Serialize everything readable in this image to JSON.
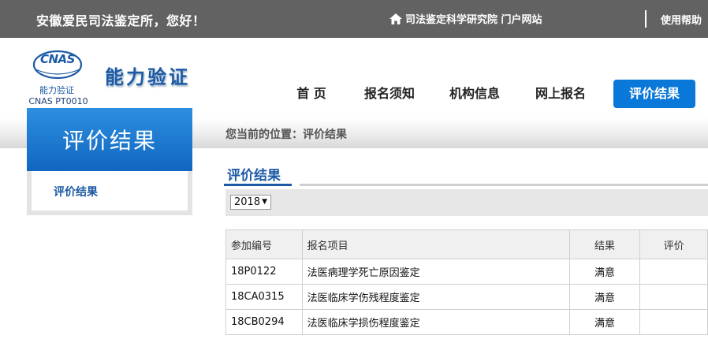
{
  "topbar": {
    "greeting": "安徽爱民司法鉴定所，您好！",
    "portal_icon": "home-icon",
    "portal_label": "司法鉴定科学研究院 门户网站",
    "help_label": "使用帮助"
  },
  "logo": {
    "mark": "CNAS",
    "sub1": "能力验证",
    "sub2": "CNAS PT0010"
  },
  "site_title": "能力验证",
  "nav": {
    "items": [
      {
        "label": "首 页"
      },
      {
        "label": "报名须知"
      },
      {
        "label": "机构信息"
      },
      {
        "label": "网上报名"
      },
      {
        "label": "评价结果",
        "active": true
      }
    ]
  },
  "sidebar": {
    "title": "评价结果",
    "items": [
      {
        "label": "评价结果"
      }
    ]
  },
  "breadcrumb": "您当前的位置：评价结果",
  "section_title": "评价结果",
  "filter": {
    "year_selected": "2018"
  },
  "table": {
    "columns": [
      "参加编号",
      "报名项目",
      "结果",
      "评价"
    ],
    "rows": [
      {
        "id": "18P0122",
        "item": "法医病理学死亡原因鉴定",
        "result": "满意",
        "evaluation": ""
      },
      {
        "id": "18CA0315",
        "item": "法医临床学伤残程度鉴定",
        "result": "满意",
        "evaluation": ""
      },
      {
        "id": "18CB0294",
        "item": "法医临床学损伤程度鉴定",
        "result": "满意",
        "evaluation": ""
      }
    ]
  },
  "colors": {
    "topbar_bg": "#626262",
    "accent": "#0a78d8",
    "brand_blue": "#1c5aa5"
  }
}
